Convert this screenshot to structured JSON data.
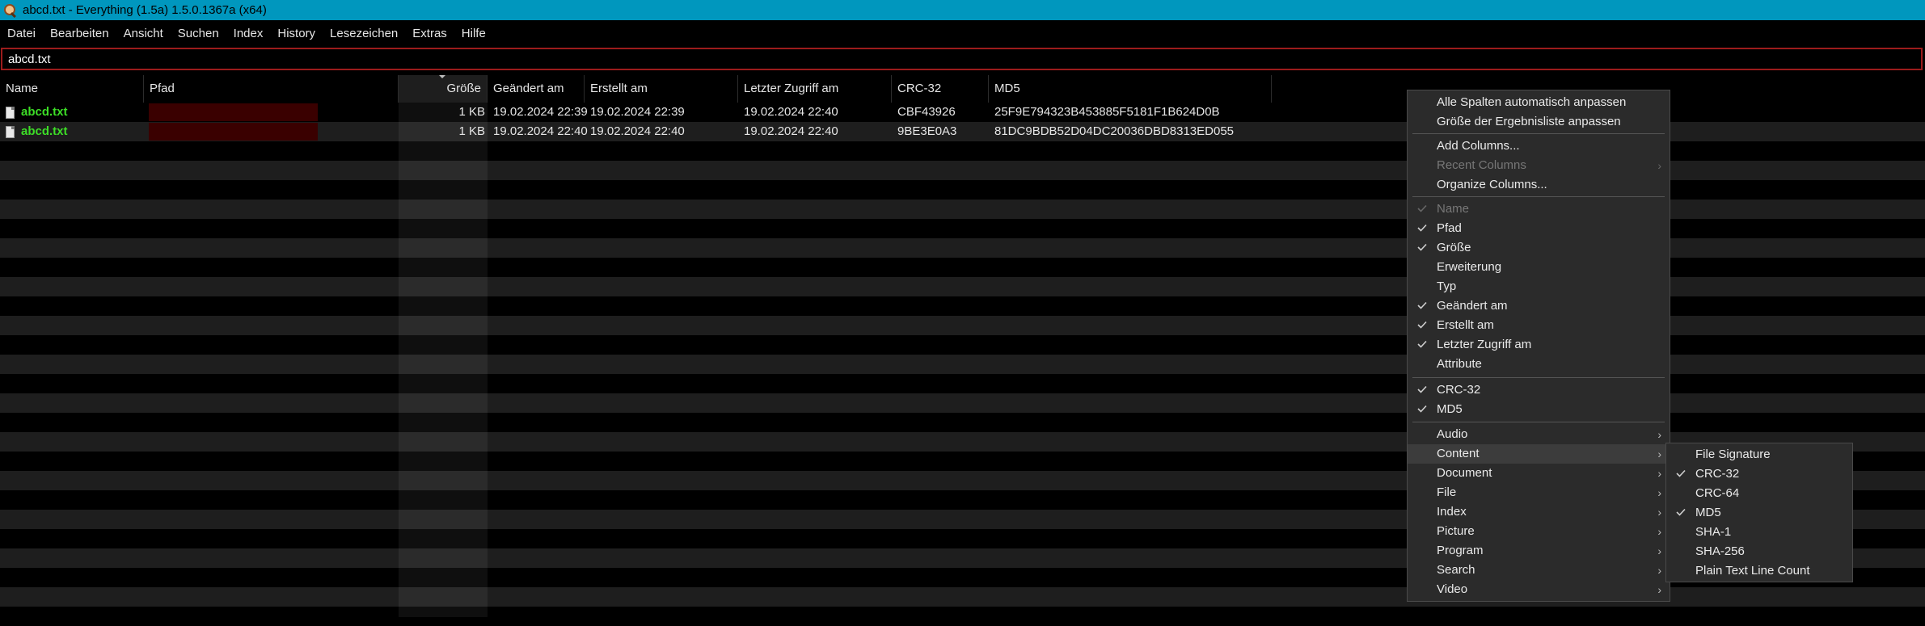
{
  "window": {
    "title": "abcd.txt - Everything (1.5a) 1.5.0.1367a (x64)"
  },
  "menu": [
    "Datei",
    "Bearbeiten",
    "Ansicht",
    "Suchen",
    "Index",
    "History",
    "Lesezeichen",
    "Extras",
    "Hilfe"
  ],
  "search": {
    "value": "abcd.txt"
  },
  "columns": [
    "Name",
    "Pfad",
    "Größe",
    "Geändert am",
    "Erstellt am",
    "Letzter Zugriff am",
    "CRC-32",
    "MD5"
  ],
  "sorted_column": "Größe",
  "rows": [
    {
      "name": "abcd.txt",
      "size": "1 KB",
      "modified": "19.02.2024 22:39",
      "created": "19.02.2024 22:39",
      "accessed": "19.02.2024 22:40",
      "crc32": "CBF43926",
      "md5": "25F9E794323B453885F5181F1B624D0B"
    },
    {
      "name": "abcd.txt",
      "size": "1 KB",
      "modified": "19.02.2024 22:40",
      "created": "19.02.2024 22:40",
      "accessed": "19.02.2024 22:40",
      "crc32": "9BE3E0A3",
      "md5": "81DC9BDB52D04DC20036DBD8313ED055"
    }
  ],
  "context_menu": {
    "fit": [
      "Alle Spalten automatisch anpassen",
      "Größe der Ergebnisliste anpassen"
    ],
    "column_actions": [
      {
        "label": "Add Columns...",
        "disabled": false,
        "submenu": false
      },
      {
        "label": "Recent Columns",
        "disabled": true,
        "submenu": true
      },
      {
        "label": "Organize Columns...",
        "disabled": false,
        "submenu": false
      }
    ],
    "standard_columns": [
      {
        "label": "Name",
        "checked": true,
        "disabled": true
      },
      {
        "label": "Pfad",
        "checked": true,
        "disabled": false
      },
      {
        "label": "Größe",
        "checked": true,
        "disabled": false
      },
      {
        "label": "Erweiterung",
        "checked": false,
        "disabled": false
      },
      {
        "label": "Typ",
        "checked": false,
        "disabled": false
      },
      {
        "label": "Geändert am",
        "checked": true,
        "disabled": false
      },
      {
        "label": "Erstellt am",
        "checked": true,
        "disabled": false
      },
      {
        "label": "Letzter Zugriff am",
        "checked": true,
        "disabled": false
      },
      {
        "label": "Attribute",
        "checked": false,
        "disabled": false
      }
    ],
    "hash_columns": [
      {
        "label": "CRC-32",
        "checked": true
      },
      {
        "label": "MD5",
        "checked": true
      }
    ],
    "categories": [
      {
        "label": "Audio",
        "highlighted": false
      },
      {
        "label": "Content",
        "highlighted": true
      },
      {
        "label": "Document",
        "highlighted": false
      },
      {
        "label": "File",
        "highlighted": false
      },
      {
        "label": "Index",
        "highlighted": false
      },
      {
        "label": "Picture",
        "highlighted": false
      },
      {
        "label": "Program",
        "highlighted": false
      },
      {
        "label": "Search",
        "highlighted": false
      },
      {
        "label": "Video",
        "highlighted": false
      }
    ]
  },
  "content_submenu": [
    {
      "label": "File Signature",
      "checked": false
    },
    {
      "label": "CRC-32",
      "checked": true
    },
    {
      "label": "CRC-64",
      "checked": false
    },
    {
      "label": "MD5",
      "checked": true
    },
    {
      "label": "SHA-1",
      "checked": false
    },
    {
      "label": "SHA-256",
      "checked": false
    },
    {
      "label": "Plain Text Line Count",
      "checked": false
    }
  ],
  "colors": {
    "titlebar": "#0097be",
    "filename": "#3dde27",
    "search_border": "#9c1c1c"
  }
}
